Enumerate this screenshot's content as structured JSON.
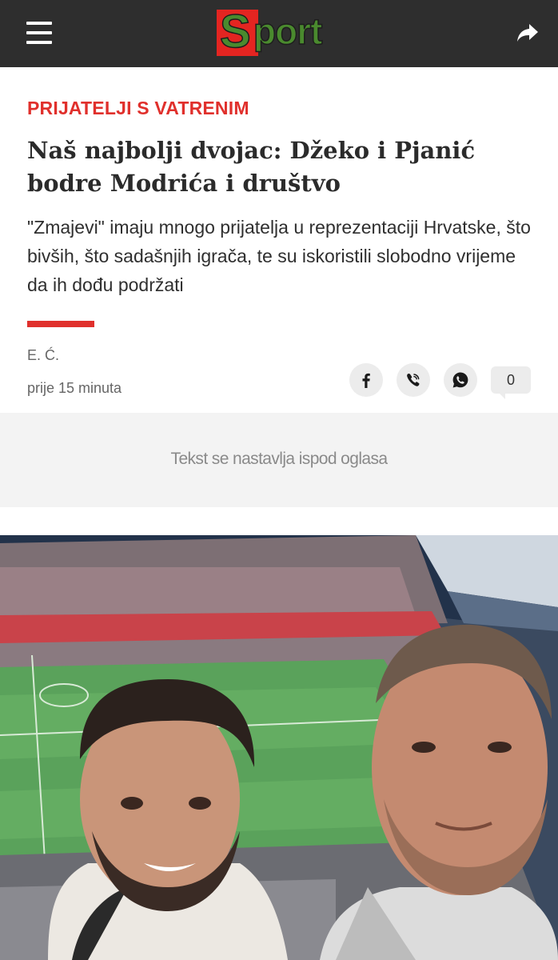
{
  "header": {
    "logo_text": "Sport",
    "menu_icon": "hamburger-menu-icon",
    "share_icon": "share-arrow-icon"
  },
  "article": {
    "kicker": "PRIJATELJI S VATRENIM",
    "title": "Naš najbolji dvojac: Džeko i Pjanić bodre Modrića i društvo",
    "lead": "\"Zmajevi\" imaju mnogo prijatelja u reprezentaciji Hrvatske, što bivših, što sadašnjih igrača, te su iskoristili slobodno vrijeme da ih dođu podržati",
    "author": "E. Ć.",
    "time": "prije 15 minuta",
    "comment_count": "0",
    "share_buttons": [
      "facebook-icon",
      "viber-icon",
      "whatsapp-icon"
    ]
  },
  "ad": {
    "notice": "Tekst se nastavlja ispod oglasa"
  },
  "photo": {
    "subject": "selfie-two-men-in-stadium"
  },
  "colors": {
    "topbar_bg": "#2e2e2e",
    "accent_red": "#e0302c",
    "logo_green": "#4a8a2e"
  }
}
